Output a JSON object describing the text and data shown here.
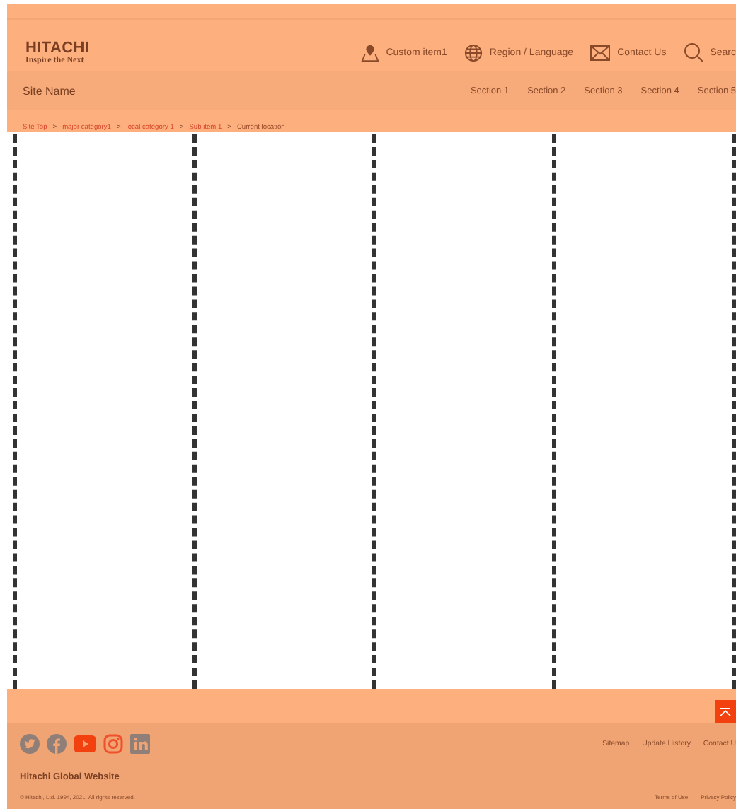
{
  "header": {
    "logo": {
      "name": "HITACHI",
      "tagline": "Inspire the Next"
    },
    "utility_links": [
      {
        "kind": "pin",
        "label": "Custom item1"
      },
      {
        "kind": "globe",
        "label": "Region / Language"
      },
      {
        "kind": "mail",
        "label": "Contact Us"
      },
      {
        "kind": "search",
        "label": "Searc"
      }
    ]
  },
  "site_nav": {
    "site_name": "Site Name",
    "sections": [
      "Section 1",
      "Section 2",
      "Section 3",
      "Section 4",
      "Section 5"
    ]
  },
  "breadcrumb": [
    "Site Top",
    "major category1",
    "local category 1",
    "Sub item 1",
    "Current location"
  ],
  "breadcrumb_separator": ">",
  "footer": {
    "social": [
      {
        "kind": "twitter"
      },
      {
        "kind": "facebook"
      },
      {
        "kind": "youtube"
      },
      {
        "kind": "instagram"
      },
      {
        "kind": "linkedin"
      }
    ],
    "links": [
      "Sitemap",
      "Update History",
      "Contact U"
    ],
    "site_title": "Hitachi Global Website",
    "copyright": "© Hitachi, Ltd. 1994, 2021. All rights reserved.",
    "legal_links": [
      "Terms of Use",
      "Privacy Policy"
    ]
  }
}
